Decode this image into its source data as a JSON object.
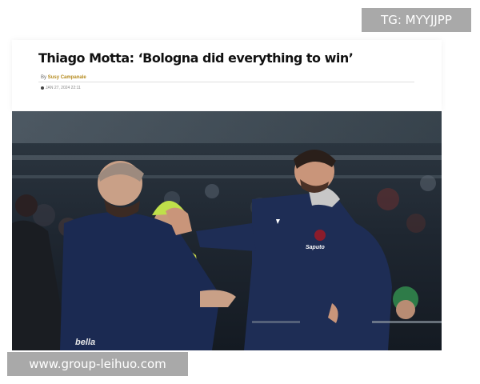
{
  "watermark_top": "TG: MYYJJPP",
  "article": {
    "title": "Thiago Motta: ‘Bologna did everything to win’",
    "byline_prefix": "By",
    "author": "Susy Campanale",
    "date": "JAN 27, 2024 22:11"
  },
  "photo": {
    "shirt_sponsor": "Saputo",
    "trim_text": "bella"
  },
  "watermark_bottom": "www.group-leihuo.com",
  "colors": {
    "accent_author": "#b58a1d",
    "watermark_bg": "#a9a9a9",
    "jacket_navy": "#1e2d55"
  }
}
